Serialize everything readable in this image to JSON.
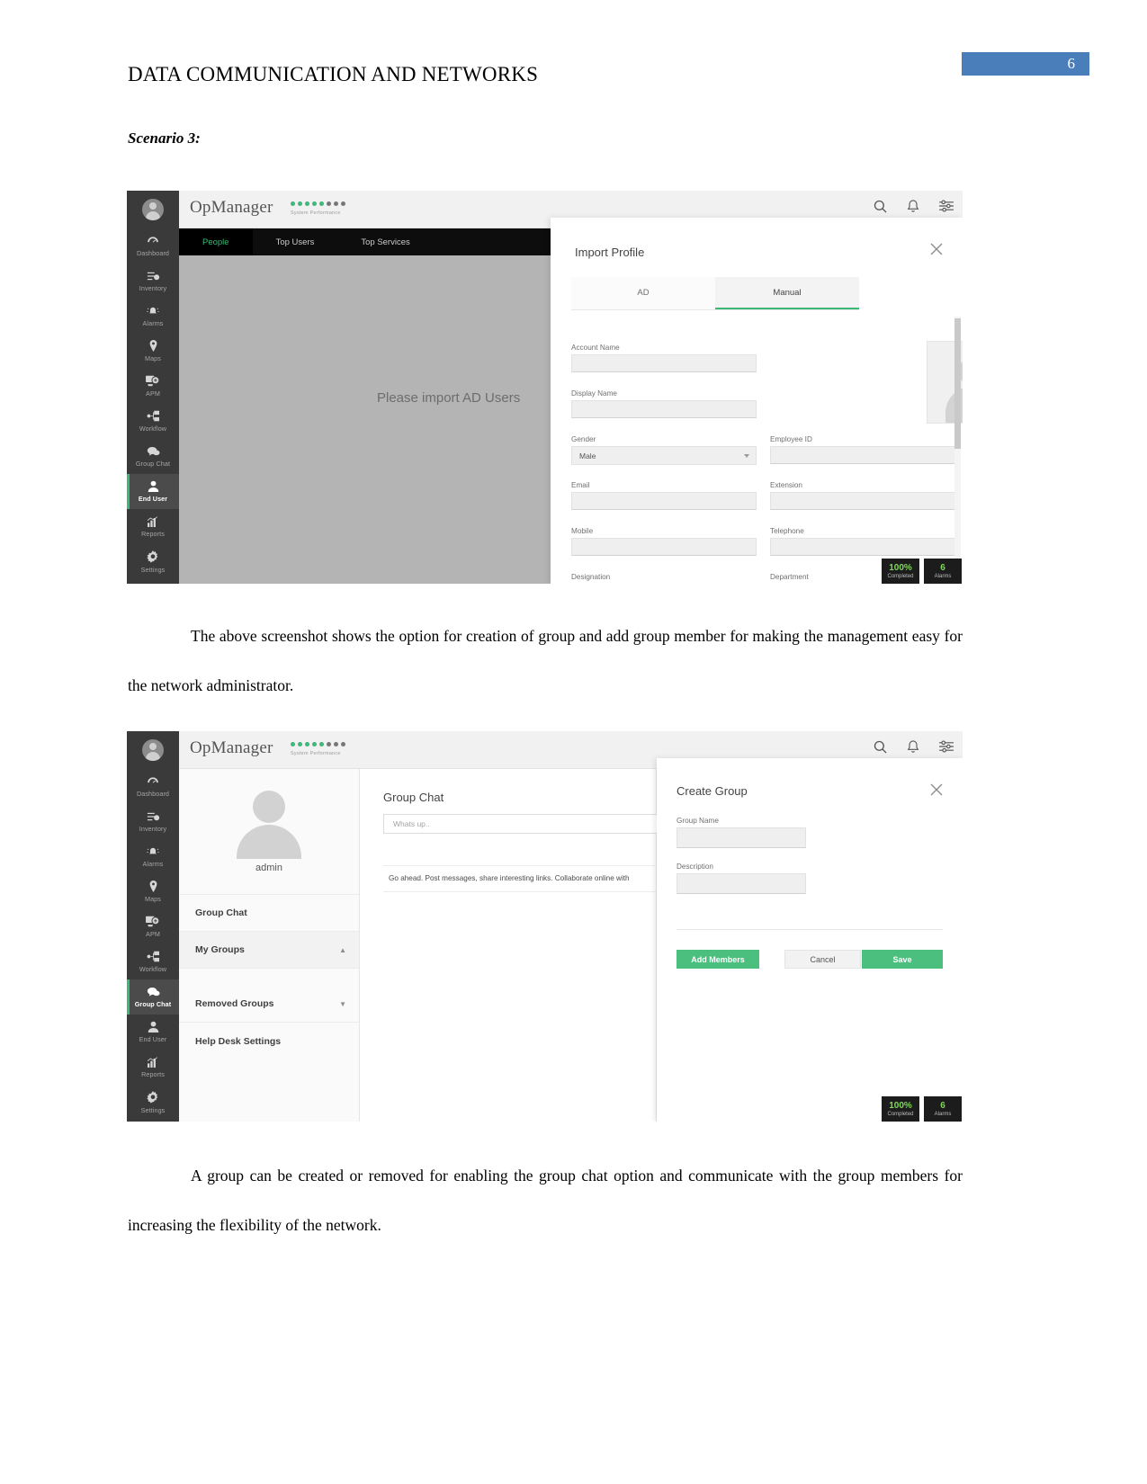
{
  "document": {
    "header_title": "DATA COMMUNICATION AND NETWORKS",
    "page_number": "6",
    "scenario_label": "Scenario 3:",
    "paragraph_1": "The above screenshot shows the option for creation of group and add group member for making the management easy for the network administrator.",
    "paragraph_2": "A group can be created or removed for enabling the group chat option and communicate with the group members for increasing the flexibility of the network."
  },
  "colors": {
    "page_badge": "#4a7ebb",
    "accent_green": "#3cb878",
    "button_green": "#4bbf7e",
    "sidebar": "#3a3a3a",
    "sidebar_active": "#4b4b4b",
    "topbar": "#f1f1f1",
    "content_gray": "#b4b4b4",
    "badge_dark": "#1c1c1c"
  },
  "screenshot_1": {
    "brand": {
      "name": "OpManager",
      "tagline": "System Performance"
    },
    "sidebar_items": [
      {
        "label": "Dashboard",
        "icon": "gauge-icon",
        "active": false
      },
      {
        "label": "Inventory",
        "icon": "list-check-icon",
        "active": false
      },
      {
        "label": "Alarms",
        "icon": "bell-alert-icon",
        "active": false
      },
      {
        "label": "Maps",
        "icon": "map-pin-icon",
        "active": false
      },
      {
        "label": "APM",
        "icon": "monitor-search-icon",
        "active": false
      },
      {
        "label": "Workflow",
        "icon": "workflow-icon",
        "active": false
      },
      {
        "label": "Group Chat",
        "icon": "chat-bubble-icon",
        "active": false
      },
      {
        "label": "End User",
        "icon": "user-icon",
        "active": true
      },
      {
        "label": "Reports",
        "icon": "bar-chart-icon",
        "active": false
      },
      {
        "label": "Settings",
        "icon": "gear-icon",
        "active": false
      }
    ],
    "subnav": [
      {
        "label": "People",
        "active": true
      },
      {
        "label": "Top Users",
        "active": false
      },
      {
        "label": "Top Services",
        "active": false
      }
    ],
    "content_message": "Please import AD Users",
    "modal": {
      "title": "Import Profile",
      "close_icon": "close-icon",
      "tabs": [
        {
          "label": "AD",
          "active": false
        },
        {
          "label": "Manual",
          "active": true
        }
      ],
      "fields": [
        {
          "label": "Account Name",
          "value": "",
          "type": "text"
        },
        {
          "label": "Display Name",
          "value": "",
          "type": "text"
        },
        {
          "label": "Gender",
          "value": "Male",
          "type": "select"
        },
        {
          "label": "Employee ID",
          "value": "",
          "type": "text"
        },
        {
          "label": "Email",
          "value": "",
          "type": "text"
        },
        {
          "label": "Extension",
          "value": "",
          "type": "text"
        },
        {
          "label": "Mobile",
          "value": "",
          "type": "text"
        },
        {
          "label": "Telephone",
          "value": "",
          "type": "text"
        },
        {
          "label": "Designation",
          "value": "",
          "type": "text"
        },
        {
          "label": "Department",
          "value": "",
          "type": "text"
        }
      ],
      "photo_placeholder": "user-photo-placeholder"
    },
    "status_badges": [
      {
        "value": "100%",
        "caption": "Completed"
      },
      {
        "value": "6",
        "caption": "Alarms"
      }
    ],
    "top_icons": [
      {
        "name": "search-icon"
      },
      {
        "name": "bell-icon"
      },
      {
        "name": "settings-sliders-icon"
      }
    ]
  },
  "screenshot_2": {
    "brand": {
      "name": "OpManager",
      "tagline": "System Performance"
    },
    "sidebar_items": [
      {
        "label": "Dashboard",
        "icon": "gauge-icon",
        "active": false
      },
      {
        "label": "Inventory",
        "icon": "list-check-icon",
        "active": false
      },
      {
        "label": "Alarms",
        "icon": "bell-alert-icon",
        "active": false
      },
      {
        "label": "Maps",
        "icon": "map-pin-icon",
        "active": false
      },
      {
        "label": "APM",
        "icon": "monitor-search-icon",
        "active": false
      },
      {
        "label": "Workflow",
        "icon": "workflow-icon",
        "active": false
      },
      {
        "label": "Group Chat",
        "icon": "chat-bubble-icon",
        "active": true
      },
      {
        "label": "End User",
        "icon": "user-icon",
        "active": false
      },
      {
        "label": "Reports",
        "icon": "bar-chart-icon",
        "active": false
      },
      {
        "label": "Settings",
        "icon": "gear-icon",
        "active": false
      }
    ],
    "left_panel": {
      "username": "admin",
      "items": [
        {
          "label": "Group Chat",
          "arrow": "",
          "shaded": false
        },
        {
          "label": "My Groups",
          "arrow": "▲",
          "shaded": true
        },
        {
          "label": "Removed Groups",
          "arrow": "▼",
          "shaded": false
        },
        {
          "label": "Help Desk Settings",
          "arrow": "",
          "shaded": false
        }
      ]
    },
    "middle_panel": {
      "title": "Group Chat",
      "input_placeholder": "Whats up..",
      "message": "Go ahead. Post messages, share interesting links. Collaborate online with"
    },
    "modal": {
      "title": "Create Group",
      "close_icon": "close-icon",
      "fields": [
        {
          "label": "Group Name",
          "value": ""
        },
        {
          "label": "Description",
          "value": ""
        }
      ],
      "buttons": [
        {
          "label": "Add Members",
          "style": "green"
        },
        {
          "label": "Cancel",
          "style": "gray"
        },
        {
          "label": "Save",
          "style": "green"
        }
      ]
    },
    "status_badges": [
      {
        "value": "100%",
        "caption": "Completed"
      },
      {
        "value": "6",
        "caption": "Alarms"
      }
    ],
    "top_icons": [
      {
        "name": "search-icon"
      },
      {
        "name": "bell-icon"
      },
      {
        "name": "settings-sliders-icon"
      }
    ]
  }
}
